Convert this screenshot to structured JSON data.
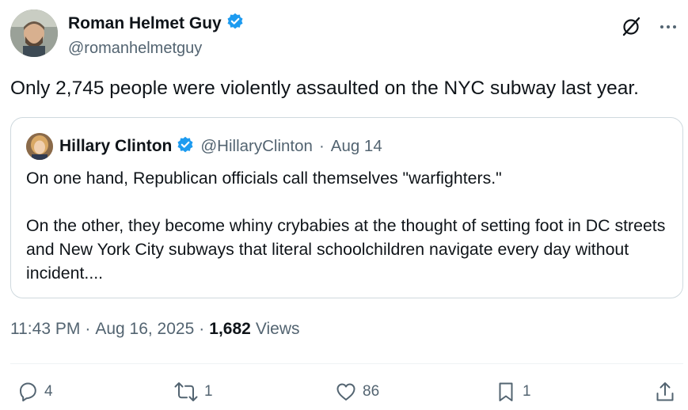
{
  "author": {
    "display_name": "Roman Helmet Guy",
    "handle": "@romanhelmetguy",
    "verified": true
  },
  "tweet": {
    "text": "Only 2,745 people were violently assaulted on the NYC subway last year."
  },
  "quoted_tweet": {
    "display_name": "Hillary Clinton",
    "handle": "@HillaryClinton",
    "separator": "·",
    "date": "Aug 14",
    "verified": true,
    "paragraph_1": "On one hand, Republican officials call themselves \"warfighters.\"",
    "paragraph_2": "On the other, they become whiny crybabies at the thought of setting foot in DC streets and New York City subways that literal schoolchildren navigate every day without incident...."
  },
  "meta": {
    "time": "11:43 PM",
    "separator": "·",
    "date": "Aug 16, 2025",
    "views_count": "1,682",
    "views_label": "Views"
  },
  "actions": {
    "replies": "4",
    "reposts": "1",
    "likes": "86",
    "bookmarks": "1"
  },
  "icons": {
    "verified": "verified-badge-icon",
    "grok": "grok-icon",
    "more": "more-icon",
    "reply": "reply-icon",
    "repost": "repost-icon",
    "like": "heart-icon",
    "bookmark": "bookmark-icon",
    "share": "share-icon"
  },
  "colors": {
    "text": "#0f1419",
    "secondary": "#536471",
    "verified": "#1d9bf0",
    "border": "#cfd9de"
  }
}
